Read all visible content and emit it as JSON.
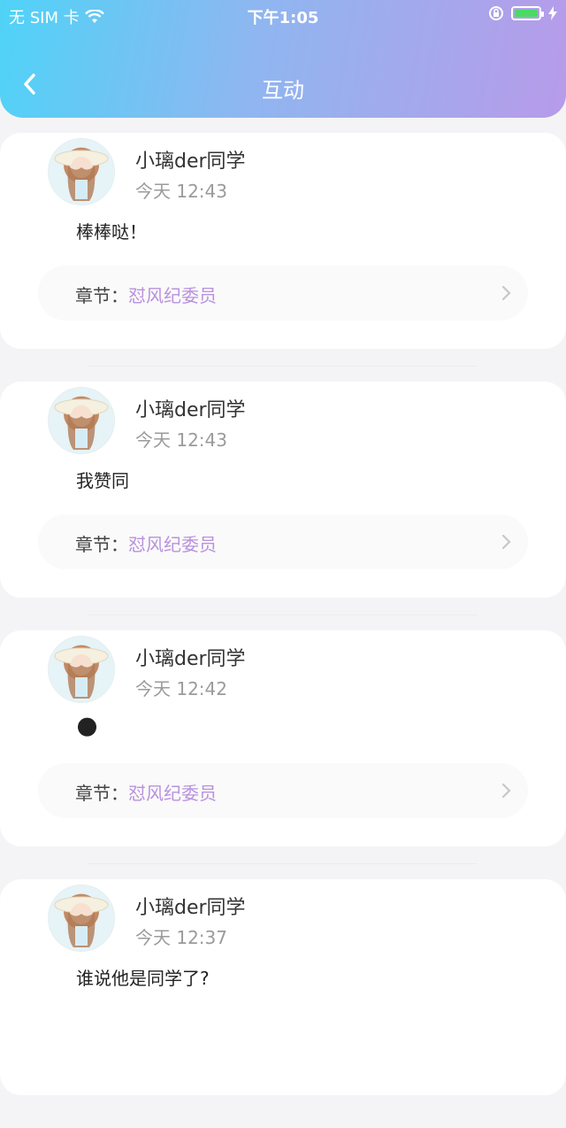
{
  "status_bar": {
    "carrier": "无 SIM 卡",
    "time": "下午1:05",
    "battery_level": 0.95
  },
  "nav": {
    "title": "互动"
  },
  "chapter_label": "章节：",
  "items": [
    {
      "user": "小璃der同学",
      "time": "今天 12:43",
      "content": "棒棒哒！",
      "chapter": "怼风纪委员"
    },
    {
      "user": "小璃der同学",
      "time": "今天 12:43",
      "content": "我赞同",
      "chapter": "怼风纪委员"
    },
    {
      "user": "小璃der同学",
      "time": "今天 12:42",
      "content": "🌑",
      "chapter": "怼风纪委员"
    },
    {
      "user": "小璃der同学",
      "time": "今天 12:37",
      "content": "谁说他是同学了?",
      "chapter": ""
    }
  ],
  "colors": {
    "header_gradient_start": "#4fd3f7",
    "header_gradient_end": "#b79be9",
    "chapter_link": "#b991de"
  }
}
